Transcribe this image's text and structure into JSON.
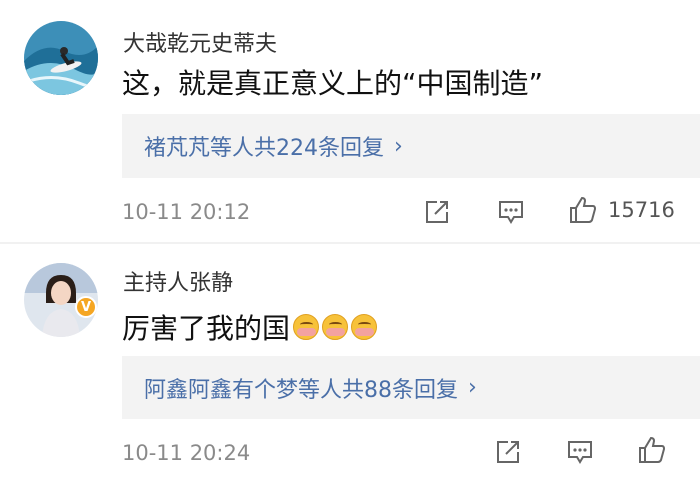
{
  "comments": [
    {
      "username": "大哉乾元史蒂夫",
      "text": "这，就是真正意义上的“中国制造”",
      "emoji_count": 0,
      "replies": {
        "names": "褚芃芃等人",
        "count_label": "共224条回复",
        "chevron": "›"
      },
      "timestamp": "10-11 20:12",
      "likes": "15716",
      "verified": false
    },
    {
      "username": "主持人张静",
      "text": "厉害了我的国",
      "emoji_count": 3,
      "replies": {
        "names": "阿鑫阿鑫有个梦等人",
        "count_label": "共88条回复",
        "chevron": "›"
      },
      "timestamp": "10-11 20:24",
      "likes": "",
      "verified": true,
      "verified_mark": "V"
    }
  ],
  "icons": {
    "share": "share-icon",
    "comment": "comment-icon",
    "like": "thumbs-up-icon",
    "emoji": "blush-emoji-icon",
    "verified": "verified-badge-icon"
  },
  "colors": {
    "link": "#4a6fa8",
    "reply_bg": "#f3f3f3",
    "muted": "#8a8a8a",
    "badge": "#f5a623"
  }
}
